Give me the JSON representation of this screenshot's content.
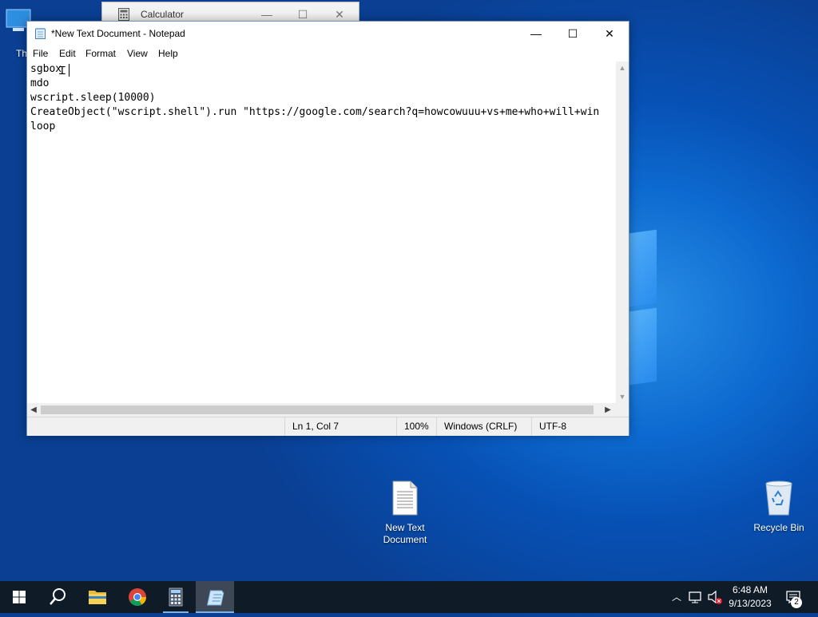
{
  "desktop": {
    "icons": [
      {
        "label": "New Text\nDocument",
        "line1": "New Text",
        "line2": "Document"
      },
      {
        "label": "Recycle Bin"
      },
      {
        "label": "Th"
      }
    ]
  },
  "calculator": {
    "title": "Calculator",
    "minimize": "—",
    "maximize": "☐",
    "close": "✕"
  },
  "notepad": {
    "title": "*New Text Document - Notepad",
    "minimize": "—",
    "maximize": "☐",
    "close": "✕",
    "menu": [
      "File",
      "Edit",
      "Format",
      "View",
      "Help"
    ],
    "lines": [
      "sgbox",
      "mdo",
      "wscript.sleep(10000)",
      "CreateObject(\"wscript.shell\").run \"https://google.com/search?q=howcowuuu+vs+me+who+will+win",
      "loop"
    ],
    "status": {
      "position": "Ln 1, Col 7",
      "zoom": "100%",
      "line_ending": "Windows (CRLF)",
      "encoding": "UTF-8"
    }
  },
  "taskbar": {
    "items": [
      {
        "name": "start",
        "icon": "windows-logo-icon"
      },
      {
        "name": "search",
        "icon": "search-icon"
      },
      {
        "name": "file-explorer",
        "icon": "folder-icon"
      },
      {
        "name": "chrome",
        "icon": "chrome-icon"
      },
      {
        "name": "calculator",
        "icon": "calculator-icon"
      },
      {
        "name": "notepad",
        "icon": "notepad-icon",
        "active": true
      }
    ],
    "clock": {
      "time": "6:48 AM",
      "date": "9/13/2023"
    },
    "notification_count": "2"
  }
}
